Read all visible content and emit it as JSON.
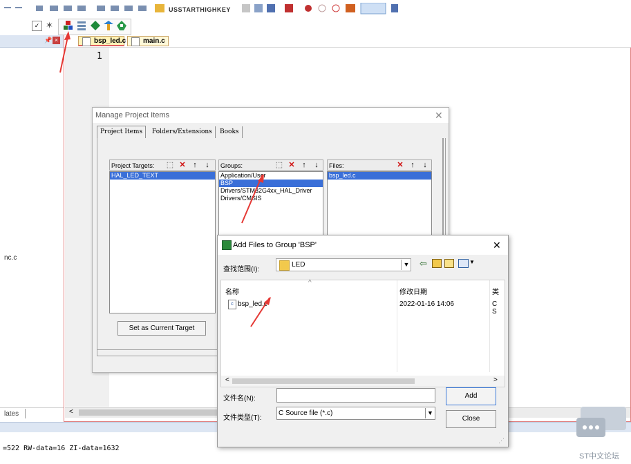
{
  "toolbar": {
    "row1_text": "USSTARTHIGHKEY"
  },
  "left_panel": {
    "file_snippet": "nc.c",
    "status_tab": "lates"
  },
  "editor": {
    "tabs": [
      {
        "label": "bsp_led.c",
        "active": true
      },
      {
        "label": "main.c",
        "active": false
      }
    ],
    "line_number": "1"
  },
  "build_output": {
    "text": "=522 RW-data=16 ZI-data=1632"
  },
  "manage_dialog": {
    "title": "Manage Project Items",
    "tabs": [
      "Project Items",
      "Folders/Extensions",
      "Books"
    ],
    "targets_header": "Project Targets:",
    "groups_header": "Groups:",
    "files_header": "Files:",
    "targets": [
      "HAL_LED_TEXT"
    ],
    "groups": [
      "Application/User",
      "BSP",
      "Drivers/STM32G4xx_HAL_Driver",
      "Drivers/CMSIS"
    ],
    "files": [
      "bsp_led.c"
    ],
    "set_current_button": "Set as Current Target"
  },
  "add_dialog": {
    "title": "Add Files to Group 'BSP'",
    "look_in_label": "查找范围(I):",
    "look_in_value": "LED",
    "col_name": "名称",
    "col_date": "修改日期",
    "col_type": "类",
    "files": [
      {
        "name": "bsp_led.c",
        "date": "2022-01-16 14:06",
        "type": "C S"
      }
    ],
    "filename_label": "文件名(N):",
    "filename_value": "",
    "filetype_label": "文件类型(T):",
    "filetype_value": "C Source file (*.c)",
    "add_button": "Add",
    "close_button": "Close"
  },
  "watermark": {
    "text": "ST中文论坛"
  },
  "colors": {
    "selection": "#3a6fd8",
    "arrow": "#e53935",
    "tab_active": "#fff3b8",
    "panel_header": "#dde6f3"
  }
}
